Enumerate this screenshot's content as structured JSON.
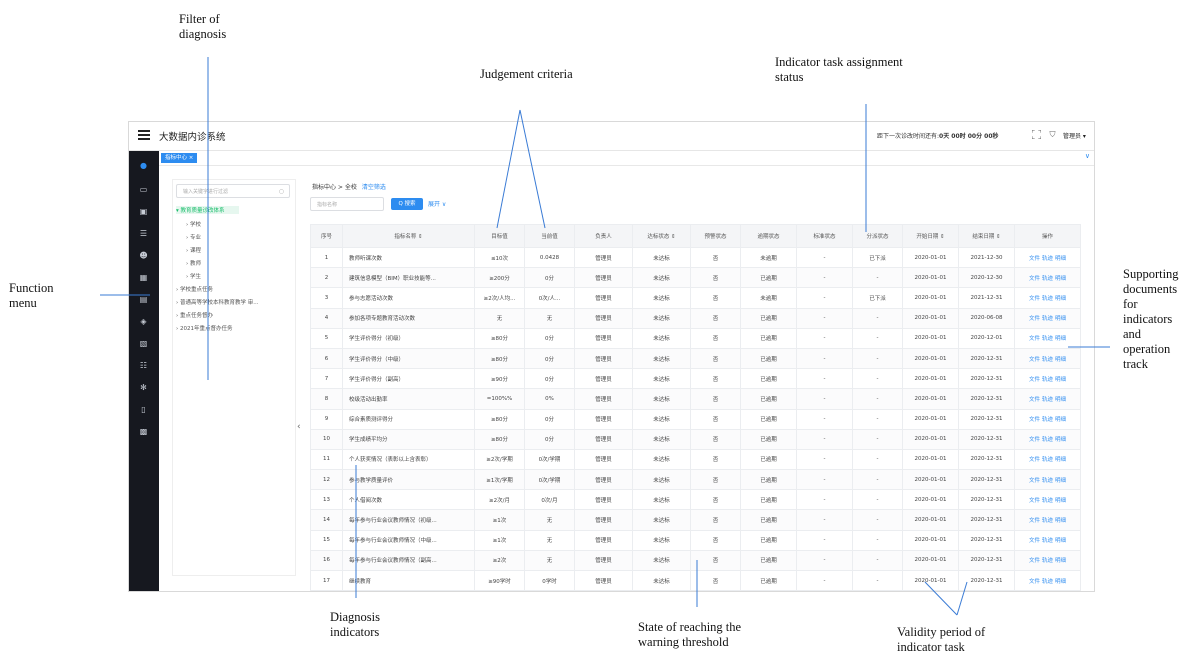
{
  "annotations": {
    "filter": [
      "Filter of",
      "diagnosis"
    ],
    "criteria": [
      "Judgement criteria"
    ],
    "assign": [
      "Indicator task assignment",
      "status"
    ],
    "function_menu": [
      "Function",
      "menu"
    ],
    "supporting": [
      "Supporting",
      "documents",
      "for",
      "indicators",
      "and",
      "operation",
      "track"
    ],
    "diag": [
      "Diagnosis",
      "indicators"
    ],
    "state": [
      "State of reaching the",
      "warning threshold"
    ],
    "validity": [
      "Validity period of",
      "indicator task"
    ]
  },
  "app": {
    "title": "大数据内诊系统",
    "countdown_prefix": "距下一次诊改时间还有:",
    "countdown_value": "0天 00时 00分 00秒",
    "user": "管理员 ▾",
    "active_tab": "指标中心 ×"
  },
  "filter": {
    "search_placeholder": "输入关键字进行过滤",
    "tree": [
      "▾ 教育质量诊改体系",
      "› 学校",
      "› 专业",
      "› 课程",
      "› 教师",
      "› 学生",
      "› 学校重点任务",
      "› 普通高等学校本科教育教学 审...",
      "› 重点任务督办",
      "› 2021年重点督办任务"
    ]
  },
  "main": {
    "breadcrumb": "指标中心 > 全校",
    "clear_filter": "清空筛选",
    "search_placeholder": "指标名称",
    "search_button": "Q 搜索",
    "expand": "展开 ∨"
  },
  "table": {
    "headers": [
      "序号",
      "指标名称 ⇕",
      "目标值",
      "当前值",
      "负责人",
      "达标状态 ⇕",
      "预警状态",
      "逾期状态",
      "标准状态",
      "分派状态",
      "开始日期 ⇕",
      "结束日期 ⇕",
      "操作"
    ],
    "ops": [
      "文件",
      "轨迹",
      "明细"
    ],
    "rows": [
      {
        "no": "1",
        "name": "教师听课次数",
        "name_color": "red",
        "target": "≤10次",
        "current": "0.0428",
        "owner": "管理员",
        "reach": "未达标",
        "warn": "否",
        "overdue": "未逾期",
        "overdue_red": false,
        "std": "-",
        "assign": "已下派",
        "start": "2020-01-01",
        "end": "2021-12-30"
      },
      {
        "no": "2",
        "name": "建筑信息模型（BIM）职业技能等...",
        "name_color": "red",
        "target": "≥200分",
        "current": "0分",
        "owner": "管理员",
        "reach": "未达标",
        "warn": "否",
        "overdue": "已逾期",
        "overdue_red": true,
        "std": "-",
        "assign": "-",
        "start": "2020-01-01",
        "end": "2020-12-30"
      },
      {
        "no": "3",
        "name": "参与志愿活动次数",
        "name_color": "red",
        "target": "≥2次/人均...",
        "current": "0次/人...",
        "owner": "管理员",
        "reach": "未达标",
        "warn": "否",
        "overdue": "未逾期",
        "overdue_red": false,
        "std": "-",
        "assign": "已下派",
        "start": "2020-01-01",
        "end": "2021-12-31"
      },
      {
        "no": "4",
        "name": "参加各项专题教育活动次数",
        "name_color": "red",
        "target": "无",
        "current": "无",
        "owner": "管理员",
        "reach": "未达标",
        "warn": "否",
        "overdue": "已逾期",
        "overdue_red": true,
        "std": "-",
        "assign": "-",
        "start": "2020-01-01",
        "end": "2020-06-08"
      },
      {
        "no": "5",
        "name": "学生评价得分（初级）",
        "name_color": "blue",
        "target": "≥80分",
        "current": "0分",
        "owner": "管理员",
        "reach": "未达标",
        "warn": "否",
        "overdue": "已逾期",
        "overdue_red": true,
        "std": "-",
        "assign": "-",
        "start": "2020-01-01",
        "end": "2020-12-01"
      },
      {
        "no": "6",
        "name": "学生评价得分（中级）",
        "name_color": "red",
        "target": "≥80分",
        "current": "0分",
        "owner": "管理员",
        "reach": "未达标",
        "warn": "否",
        "overdue": "已逾期",
        "overdue_red": true,
        "std": "-",
        "assign": "-",
        "start": "2020-01-01",
        "end": "2020-12-31"
      },
      {
        "no": "7",
        "name": "学生评价得分（副高）",
        "name_color": "red",
        "target": "≥90分",
        "current": "0分",
        "owner": "管理员",
        "reach": "未达标",
        "warn": "否",
        "overdue": "已逾期",
        "overdue_red": true,
        "std": "-",
        "assign": "-",
        "start": "2020-01-01",
        "end": "2020-12-31"
      },
      {
        "no": "8",
        "name": "校级活动出勤率",
        "name_color": "red",
        "target": "=100%%",
        "current": "0%",
        "owner": "管理员",
        "reach": "未达标",
        "warn": "否",
        "overdue": "已逾期",
        "overdue_red": true,
        "std": "-",
        "assign": "-",
        "start": "2020-01-01",
        "end": "2020-12-31"
      },
      {
        "no": "9",
        "name": "综合素质测评得分",
        "name_color": "blue",
        "target": "≥80分",
        "current": "0分",
        "owner": "管理员",
        "reach": "未达标",
        "warn": "否",
        "overdue": "已逾期",
        "overdue_red": true,
        "std": "-",
        "assign": "-",
        "start": "2020-01-01",
        "end": "2020-12-31"
      },
      {
        "no": "10",
        "name": "学生成绩平均分",
        "name_color": "red",
        "target": "≥80分",
        "current": "0分",
        "owner": "管理员",
        "reach": "未达标",
        "warn": "否",
        "overdue": "已逾期",
        "overdue_red": true,
        "std": "-",
        "assign": "-",
        "start": "2020-01-01",
        "end": "2020-12-31"
      },
      {
        "no": "11",
        "name": "个人获奖情况（表彰以上含表彰）",
        "name_color": "blue",
        "target": "≥2次/学期",
        "current": "0次/学期",
        "owner": "管理员",
        "reach": "未达标",
        "warn": "否",
        "overdue": "已逾期",
        "overdue_red": true,
        "std": "-",
        "assign": "-",
        "start": "2020-01-01",
        "end": "2020-12-31"
      },
      {
        "no": "12",
        "name": "参与教学质量评价",
        "name_color": "blue",
        "target": "≥1次/学期",
        "current": "0次/学期",
        "owner": "管理员",
        "reach": "未达标",
        "warn": "否",
        "overdue": "已逾期",
        "overdue_red": true,
        "std": "-",
        "assign": "-",
        "start": "2020-01-01",
        "end": "2020-12-31"
      },
      {
        "no": "13",
        "name": "个人借阅次数",
        "name_color": "blue",
        "target": "≥2次/月",
        "current": "0次/月",
        "owner": "管理员",
        "reach": "未达标",
        "warn": "否",
        "overdue": "已逾期",
        "overdue_red": true,
        "std": "-",
        "assign": "-",
        "start": "2020-01-01",
        "end": "2020-12-31"
      },
      {
        "no": "14",
        "name": "每年参与行业会议教师情况（初级...",
        "name_color": "blue",
        "target": "≥1次",
        "current": "无",
        "owner": "管理员",
        "reach": "未达标",
        "warn": "否",
        "overdue": "已逾期",
        "overdue_red": true,
        "std": "-",
        "assign": "-",
        "start": "2020-01-01",
        "end": "2020-12-31"
      },
      {
        "no": "15",
        "name": "每年参与行业会议教师情况（中级...",
        "name_color": "blue",
        "target": "≥1次",
        "current": "无",
        "owner": "管理员",
        "reach": "未达标",
        "warn": "否",
        "overdue": "已逾期",
        "overdue_red": true,
        "std": "-",
        "assign": "-",
        "start": "2020-01-01",
        "end": "2020-12-31"
      },
      {
        "no": "16",
        "name": "每年参与行业会议教师情况（副高...",
        "name_color": "blue",
        "target": "≥2次",
        "current": "无",
        "owner": "管理员",
        "reach": "未达标",
        "warn": "否",
        "overdue": "已逾期",
        "overdue_red": true,
        "std": "-",
        "assign": "-",
        "start": "2020-01-01",
        "end": "2020-12-31"
      },
      {
        "no": "17",
        "name": "继续教育",
        "name_color": "blue",
        "target": "≥90学时",
        "current": "0学时",
        "owner": "管理员",
        "reach": "未达标",
        "warn": "否",
        "overdue": "已逾期",
        "overdue_red": true,
        "std": "-",
        "assign": "-",
        "start": "2020-01-01",
        "end": "2020-12-31"
      }
    ]
  }
}
